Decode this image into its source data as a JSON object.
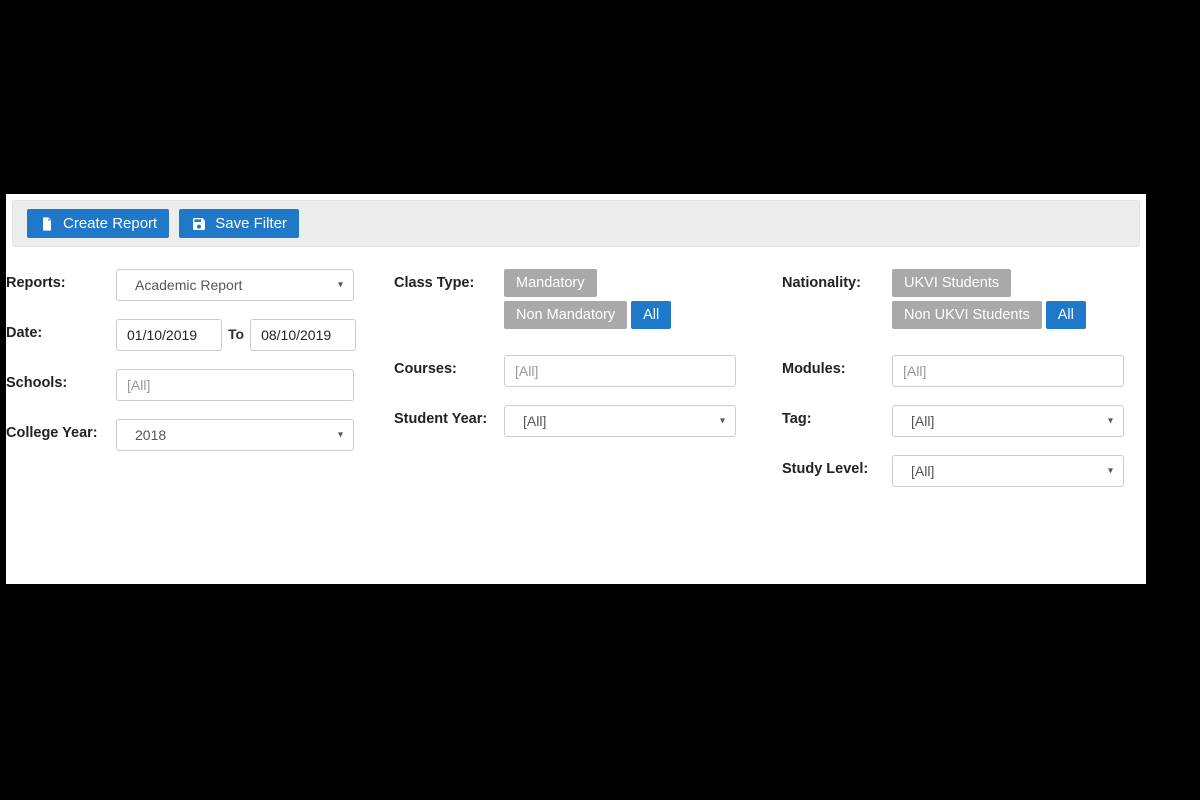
{
  "toolbar": {
    "create_report_label": "Create Report",
    "save_filter_label": "Save Filter"
  },
  "labels": {
    "reports": "Reports:",
    "date": "Date:",
    "date_to": "To",
    "schools": "Schools:",
    "college_year": "College Year:",
    "class_type": "Class Type:",
    "courses": "Courses:",
    "student_year": "Student Year:",
    "nationality": "Nationality:",
    "modules": "Modules:",
    "tag": "Tag:",
    "study_level": "Study Level:"
  },
  "values": {
    "reports": "Academic Report",
    "date_from": "01/10/2019",
    "date_to": "08/10/2019",
    "schools": "[All]",
    "college_year": "2018",
    "courses": "[All]",
    "student_year": "[All]",
    "modules": "[All]",
    "tag": "[All]",
    "study_level": "[All]"
  },
  "class_type": {
    "options": [
      "Mandatory",
      "Non Mandatory",
      "All"
    ],
    "active": "All"
  },
  "nationality": {
    "options": [
      "UKVI Students",
      "Non UKVI Students",
      "All"
    ],
    "active": "All"
  }
}
